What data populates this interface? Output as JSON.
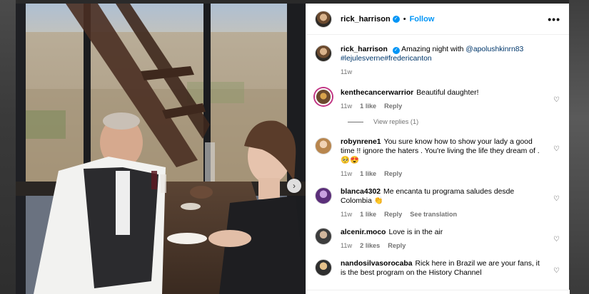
{
  "header": {
    "username": "rick_harrison",
    "separator": "•",
    "follow": "Follow",
    "more": "•••"
  },
  "caption": {
    "username": "rick_harrison",
    "text_before": "Amazing night with ",
    "mention": "@apolushkinrn83",
    "hashtags": "#lejulesverne#fredericanton",
    "age": "11w"
  },
  "comments": [
    {
      "username": "kenthecancerwarrior",
      "text": "Beautiful daughter!",
      "age": "11w",
      "likes": "1 like",
      "reply": "Reply",
      "extra": ""
    },
    {
      "username": "robynrene1",
      "text": "You sure know how to show your lady a good time !! ignore the haters . You're living the life they dream of . 🥺😍",
      "age": "11w",
      "likes": "1 like",
      "reply": "Reply",
      "extra": ""
    },
    {
      "username": "blanca4302",
      "text": "Me encanta tu programa saludes desde Colombia 👏",
      "age": "11w",
      "likes": "1 like",
      "reply": "Reply",
      "extra": "See translation"
    },
    {
      "username": "alcenir.moco",
      "text": "Love is in the air",
      "age": "11w",
      "likes": "2 likes",
      "reply": "Reply",
      "extra": ""
    },
    {
      "username": "nandosilvasorocaba",
      "text": "Rick here in Brazil we are your fans, it is the best program on the History Channel",
      "age": "",
      "likes": "",
      "reply": "",
      "extra": ""
    }
  ],
  "view_replies": "View replies (1)",
  "icons": {
    "verified": "verified-badge-icon",
    "heart": "heart-icon",
    "next": "chevron-right-icon",
    "more": "more-options-icon"
  },
  "colors": {
    "accent": "#0095f6",
    "mention": "#00376b",
    "meta": "#737373"
  }
}
